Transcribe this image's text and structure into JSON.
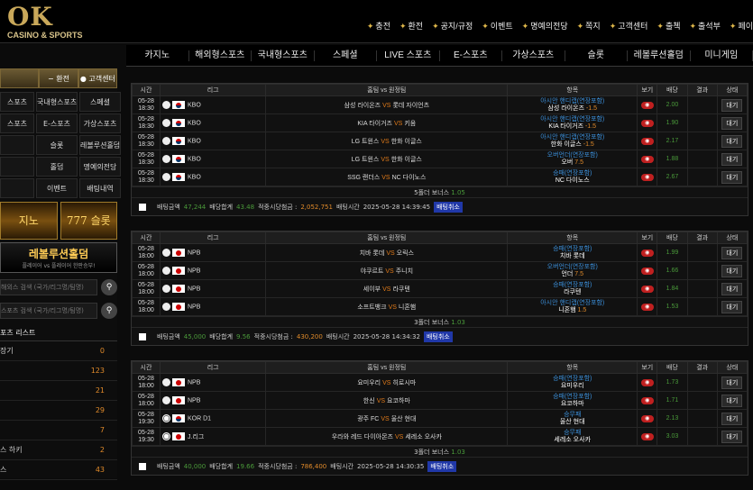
{
  "logo": {
    "title": "OK",
    "subtitle": "CASINO & SPORTS"
  },
  "toplinks": [
    "충전",
    "환전",
    "공지/규정",
    "이벤트",
    "명예의전당",
    "쪽지",
    "고객센터",
    "출첵",
    "출석부",
    "페이"
  ],
  "menu": [
    "카지노",
    "해외형스포츠",
    "국내형스포츠",
    "스페셜",
    "LIVE 스포츠",
    "E-스포츠",
    "가상스포츠",
    "슬롯",
    "레볼루션홀덤",
    "미니게임"
  ],
  "sidebar": {
    "top_buttons": [
      "",
      "환전",
      "고객센터"
    ],
    "grid": [
      "스포츠",
      "국내형스포츠",
      "스페셜",
      "스포츠",
      "E-스포츠",
      "가상스포츠",
      "",
      "슬롯",
      "레볼루션홀덤",
      "",
      "홀덤",
      "명예의전당",
      "",
      "이벤트",
      "배팅내역"
    ],
    "banner_casino": "지노",
    "banner_slot": "777 슬롯",
    "banner_holdem_title": "레볼루션홀덤",
    "banner_holdem_sub": "플레이어 vs 플레이어 한판승부!",
    "search1": "해외스 검색 (국가/리그명/팀명)",
    "search2": "스포츠 검색 (국가/리그명/팀명)",
    "list_title": "포츠 리스트",
    "list": [
      {
        "label": "장기",
        "count": "0"
      },
      {
        "label": "",
        "count": "123"
      },
      {
        "label": "",
        "count": "21"
      },
      {
        "label": "",
        "count": "29"
      },
      {
        "label": "",
        "count": "7"
      },
      {
        "label": "스 하키",
        "count": "2"
      },
      {
        "label": "스",
        "count": "43"
      }
    ]
  },
  "headers": [
    "시간",
    "리그",
    "홈팀 vs 원정팀",
    "항목",
    "보기",
    "배당",
    "결과",
    "상태"
  ],
  "blocks": [
    {
      "rows": [
        {
          "date": "05-28",
          "time": "18:30",
          "flag": "kr",
          "ball": "base",
          "league": "KBO",
          "home": "삼성 라이온즈",
          "away": "롯데 자이언츠",
          "item1": "아시안 핸디캡(연장포함)",
          "item2": "삼성 라이온즈",
          "hc": "-1.5",
          "odds": "2.00",
          "status": "대기"
        },
        {
          "date": "05-28",
          "time": "18:30",
          "flag": "kr",
          "ball": "base",
          "league": "KBO",
          "home": "KIA 타이거즈",
          "away": "키움",
          "item1": "아시안 핸디캡(연장포함)",
          "item2": "KIA 타이거즈",
          "hc": "-1.5",
          "odds": "1.90",
          "status": "대기"
        },
        {
          "date": "05-28",
          "time": "18:30",
          "flag": "kr",
          "ball": "base",
          "league": "KBO",
          "home": "LG 트윈스",
          "away": "한화 이글스",
          "item1": "아시안 핸디캡(연장포함)",
          "item2": "한화 이글스",
          "hc": "-1.5",
          "odds": "2.17",
          "status": "대기"
        },
        {
          "date": "05-28",
          "time": "18:30",
          "flag": "kr",
          "ball": "base",
          "league": "KBO",
          "home": "LG 트윈스",
          "away": "한화 이글스",
          "item1": "오버언더(연장포함)",
          "item2": "오버",
          "hc": "7.5",
          "odds": "1.88",
          "status": "대기"
        },
        {
          "date": "05-28",
          "time": "18:30",
          "flag": "kr",
          "ball": "base",
          "league": "KBO",
          "home": "SSG 랜더스",
          "away": "NC 다이노스",
          "item1": "승패(연장포함)",
          "item2": "NC 다이노스",
          "hc": "",
          "odds": "2.67",
          "status": "대기"
        }
      ],
      "bonus_label": "5폴더 보너스",
      "bonus_value": "1.05",
      "footer": {
        "amount_label": "배팅금액",
        "amount": "47,244",
        "total_label": "배당합계",
        "total": "43.48",
        "win_label": "적중시당첨금 :",
        "win": "2,052,751",
        "time_label": "배팅시간",
        "time": "2025-05-28 14:39:45",
        "cancel": "배팅취소"
      }
    },
    {
      "rows": [
        {
          "date": "05-28",
          "time": "18:00",
          "flag": "jp",
          "ball": "base",
          "league": "NPB",
          "home": "치바 롯데",
          "away": "오릭스",
          "item1": "승패(연장포함)",
          "item2": "치바 롯데",
          "hc": "",
          "odds": "1.99",
          "status": "대기"
        },
        {
          "date": "05-28",
          "time": "18:00",
          "flag": "jp",
          "ball": "base",
          "league": "NPB",
          "home": "야쿠르트",
          "away": "주니치",
          "item1": "오버언더(연장포함)",
          "item2": "언더",
          "hc": "7.5",
          "odds": "1.66",
          "status": "대기"
        },
        {
          "date": "05-28",
          "time": "18:00",
          "flag": "jp",
          "ball": "base",
          "league": "NPB",
          "home": "세이부",
          "away": "라쿠텐",
          "item1": "승패(연장포함)",
          "item2": "라쿠텐",
          "hc": "",
          "odds": "1.84",
          "status": "대기"
        },
        {
          "date": "05-28",
          "time": "18:00",
          "flag": "jp",
          "ball": "base",
          "league": "NPB",
          "home": "소프트뱅크",
          "away": "니혼햄",
          "item1": "아시안 핸디캡(연장포함)",
          "item2": "니혼햄",
          "hc": "1.5",
          "odds": "1.53",
          "status": "대기"
        }
      ],
      "bonus_label": "3폴더 보너스",
      "bonus_value": "1.03",
      "footer": {
        "amount_label": "배팅금액",
        "amount": "45,000",
        "total_label": "배당합계",
        "total": "9.56",
        "win_label": "적중시당첨금 :",
        "win": "430,200",
        "time_label": "배팅시간",
        "time": "2025-05-28 14:34:32",
        "cancel": "배팅취소"
      }
    },
    {
      "rows": [
        {
          "date": "05-28",
          "time": "18:00",
          "flag": "jp",
          "ball": "base",
          "league": "NPB",
          "home": "요미우리",
          "away": "히로시마",
          "item1": "승패(연장포함)",
          "item2": "요미우리",
          "hc": "",
          "odds": "1.73",
          "status": "대기"
        },
        {
          "date": "05-28",
          "time": "18:00",
          "flag": "jp",
          "ball": "base",
          "league": "NPB",
          "home": "한신",
          "away": "요코하마",
          "item1": "승패(연장포함)",
          "item2": "요코하마",
          "hc": "",
          "odds": "1.71",
          "status": "대기"
        },
        {
          "date": "05-28",
          "time": "19:30",
          "flag": "kr",
          "ball": "soccer",
          "league": "KOR D1",
          "home": "광주 FC",
          "away": "울산 현대",
          "item1": "승무패",
          "item2": "울산 현대",
          "hc": "",
          "odds": "2.13",
          "status": "대기"
        },
        {
          "date": "05-28",
          "time": "19:30",
          "flag": "jp",
          "ball": "soccer",
          "league": "J.리그",
          "home": "우라와 레드 다이아몬즈",
          "away": "세레소 오사카",
          "item1": "승무패",
          "item2": "세레소 오사카",
          "hc": "",
          "odds": "3.03",
          "status": "대기"
        }
      ],
      "bonus_label": "3폴더 보너스",
      "bonus_value": "1.03",
      "footer": {
        "amount_label": "배팅금액",
        "amount": "40,000",
        "total_label": "배당합계",
        "total": "19.66",
        "win_label": "적중시당첨금 :",
        "win": "786,400",
        "time_label": "배팅시간",
        "time": "2025-05-28 14:30:35",
        "cancel": "배팅취소"
      }
    }
  ]
}
